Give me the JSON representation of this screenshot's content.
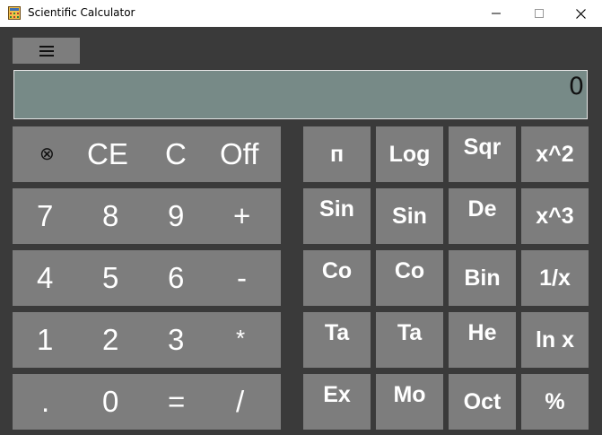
{
  "window": {
    "title": "Scientific Calculator",
    "minimize": "─",
    "maximize": "☐",
    "close": "✕"
  },
  "menu": {
    "label": "≡"
  },
  "display": {
    "value": "0"
  },
  "basic": {
    "row1": [
      "⊗",
      "CE",
      "C",
      "Off"
    ],
    "row2": [
      "7",
      "8",
      "9",
      "+"
    ],
    "row3": [
      "4",
      "5",
      "6",
      "-"
    ],
    "row4": [
      "1",
      "2",
      "3",
      "*"
    ],
    "row5": [
      ".",
      "0",
      "=",
      "/"
    ]
  },
  "scientific": {
    "col1": [
      "п",
      "Sin",
      "Co",
      "Ta",
      "Ex"
    ],
    "col2": [
      "Log",
      "Sin",
      "Co",
      "Ta",
      "Mo"
    ],
    "col3": [
      "Sqr",
      "De",
      "Bin",
      "He",
      "Oct"
    ],
    "col4": [
      "x^2",
      "x^3",
      "1/x",
      "ln x",
      "%"
    ]
  },
  "colors": {
    "background": "#3a3a3a",
    "button": "#7d7d7d",
    "display": "#778a87",
    "text": "#ffffff"
  }
}
